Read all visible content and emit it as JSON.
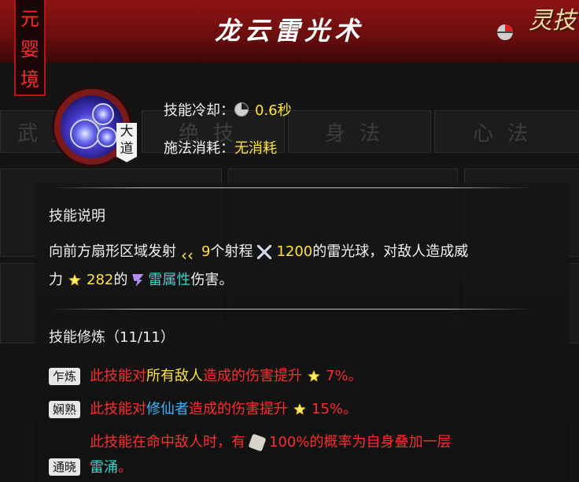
{
  "header": {
    "realm": [
      "元",
      "婴",
      "境"
    ],
    "title": "龙云雷光术",
    "type_badge": "灵技"
  },
  "bg_tabs": [
    "武技",
    "绝技",
    "身法",
    "心法"
  ],
  "skill": {
    "tier_badge": [
      "大",
      "道"
    ],
    "cooldown_label": "技能冷却：",
    "cooldown_value": "0.6秒",
    "cost_label": "施法消耗：",
    "cost_value": "无消耗"
  },
  "description": {
    "title": "技能说明",
    "line1_a": "向前方扇形区域发射",
    "count": "9",
    "line1_b": "个射程",
    "range": "1200",
    "line1_c": "的雷光球，对敌人造成威",
    "line2_a": "力",
    "power": "282",
    "line2_b": "的",
    "element": "雷属性",
    "line2_c": "伤害。"
  },
  "cultivation": {
    "title": "技能修炼（11/11）",
    "items": [
      {
        "badge": "乍炼",
        "text_a": "此技能对",
        "highlight": "所有敌人",
        "text_b": "造成的伤害提升",
        "value": "7%。"
      },
      {
        "badge": "娴熟",
        "text_a": "此技能对",
        "highlight": "修仙者",
        "text_b": "造成的伤害提升",
        "value": "15%。"
      },
      {
        "badge": "通晓",
        "text_a": "此技能在命中敌人时，有",
        "value": "100%的概率为自身叠加一层",
        "highlight": "雷涌",
        "text_b": "。"
      }
    ]
  },
  "colors": {
    "header_red": "#8e1414",
    "value_yellow": "#ffe23c",
    "element_cyan": "#37d5c9",
    "effect_red": "#ff2c2c",
    "highlight_blue": "#35b6ff"
  },
  "icons": {
    "cooldown": "clock-icon",
    "count": "arrows-icon",
    "range": "cross-arrows-icon",
    "power": "burst-icon",
    "element": "lightning-icon",
    "chance": "stone-icon"
  }
}
